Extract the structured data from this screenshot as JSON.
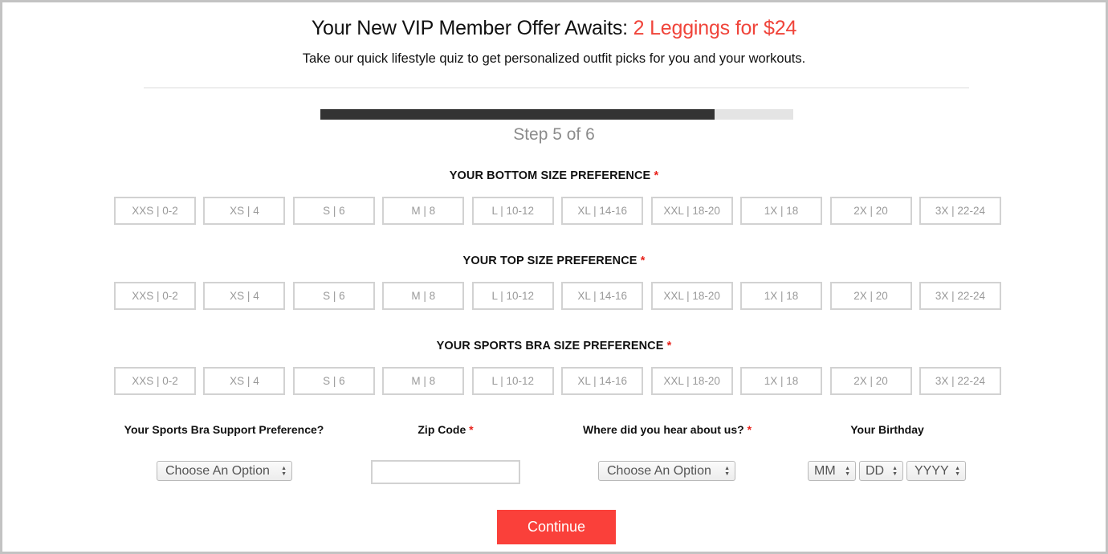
{
  "header": {
    "title_prefix": "Your New VIP Member Offer Awaits: ",
    "title_offer": "2 Leggings for $24",
    "subtitle": "Take our quick lifestyle quiz to get personalized outfit picks for you and your workouts.",
    "accent_color": "#f0443a"
  },
  "progress": {
    "current_step": 5,
    "total_steps": 6,
    "fraction_complete": 0.833,
    "label": "Step 5 of 6"
  },
  "sections": [
    {
      "label": "YOUR BOTTOM SIZE PREFERENCE",
      "required_mark": "*",
      "options": [
        "XXS | 0-2",
        "XS | 4",
        "S | 6",
        "M | 8",
        "L | 10-12",
        "XL | 14-16",
        "XXL | 18-20",
        "1X | 18",
        "2X | 20",
        "3X | 22-24"
      ]
    },
    {
      "label": "YOUR TOP SIZE PREFERENCE",
      "required_mark": "*",
      "options": [
        "XXS | 0-2",
        "XS | 4",
        "S | 6",
        "M | 8",
        "L | 10-12",
        "XL | 14-16",
        "XXL | 18-20",
        "1X | 18",
        "2X | 20",
        "3X | 22-24"
      ]
    },
    {
      "label": "YOUR SPORTS BRA SIZE PREFERENCE",
      "required_mark": "*",
      "options": [
        "XXS | 0-2",
        "XS | 4",
        "S | 6",
        "M | 8",
        "L | 10-12",
        "XL | 14-16",
        "XXL | 18-20",
        "1X | 18",
        "2X | 20",
        "3X | 22-24"
      ]
    }
  ],
  "fields": {
    "support": {
      "label": "Your Sports Bra Support Preference?",
      "value": "Choose An Option"
    },
    "zip": {
      "label": "Zip Code",
      "required_mark": "*",
      "value": "",
      "placeholder": ""
    },
    "source": {
      "label": "Where did you hear about us?",
      "required_mark": "*",
      "value": "Choose An Option"
    },
    "birthday": {
      "label": "Your Birthday",
      "month": "MM",
      "day": "DD",
      "year": "YYYY"
    }
  },
  "continue_label": "Continue",
  "continue_color": "#fa403a"
}
